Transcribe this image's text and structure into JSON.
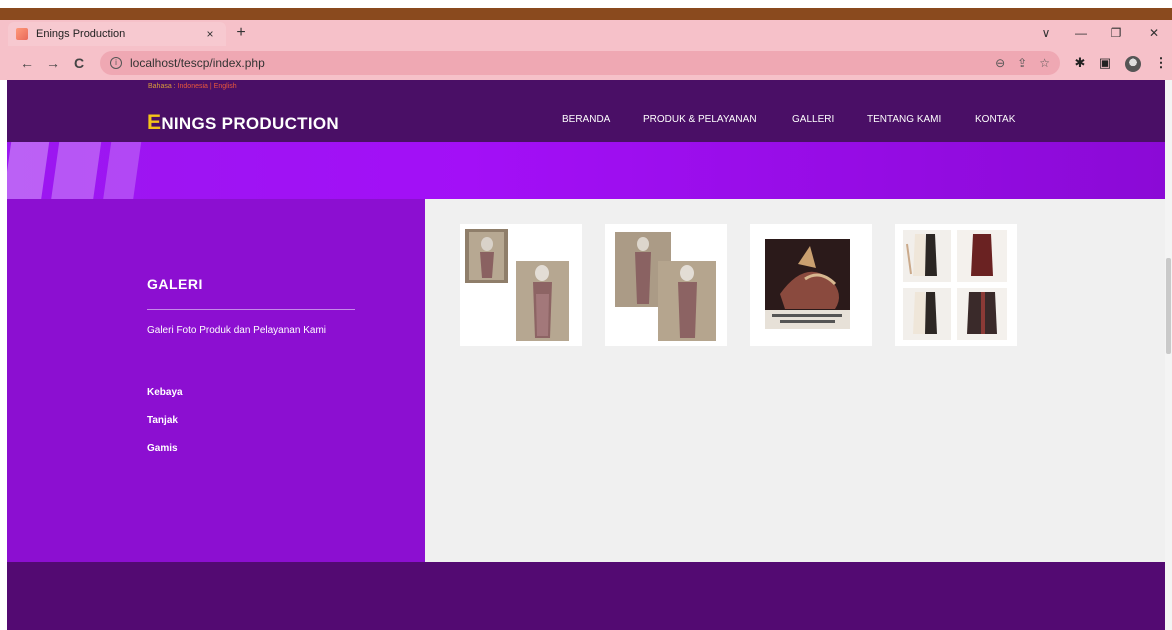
{
  "browser": {
    "tab_title": "Enings Production",
    "tab_close": "×",
    "new_tab": "+",
    "url": "localhost/tescp/index.php",
    "info_glyph": "i",
    "back": "←",
    "forward": "→",
    "reload": "C",
    "controls": {
      "collapse": "∨",
      "minimize": "—",
      "restore": "❐",
      "close": "✕"
    },
    "omni_icons": {
      "zoom": "⊖",
      "share": "⇪",
      "bookmark": "☆"
    },
    "ext_icons": {
      "extensions": "✱",
      "side_panel": "▣",
      "menu": "⋮"
    }
  },
  "header": {
    "lang_prefix": "Bahasa : ",
    "lang_indonesia": "Indonesia",
    "lang_sep": " | ",
    "lang_english": "English",
    "brand_initial": "E",
    "brand_rest": "NINGS PRODUCTION",
    "nav": [
      "BERANDA",
      "PRODUK & PELAYANAN",
      "GALLERI",
      "TENTANG KAMI",
      "KONTAK"
    ]
  },
  "sidebar": {
    "title": "GALERI",
    "description": "Galeri Foto Produk dan Pelayanan Kami",
    "links": [
      "Kebaya",
      "Tanjak",
      "Gamis"
    ]
  },
  "gallery": {
    "items": [
      "kebaya-photo-1",
      "kebaya-photo-2",
      "tanjak-photo",
      "gamis-photo"
    ]
  },
  "colors": {
    "header_bg": "#4a0f66",
    "banner": "#a30ff7",
    "sidebar_bg": "#8c0fd1",
    "footer_bg": "#530a72",
    "brand_accent": "#f5c518"
  }
}
